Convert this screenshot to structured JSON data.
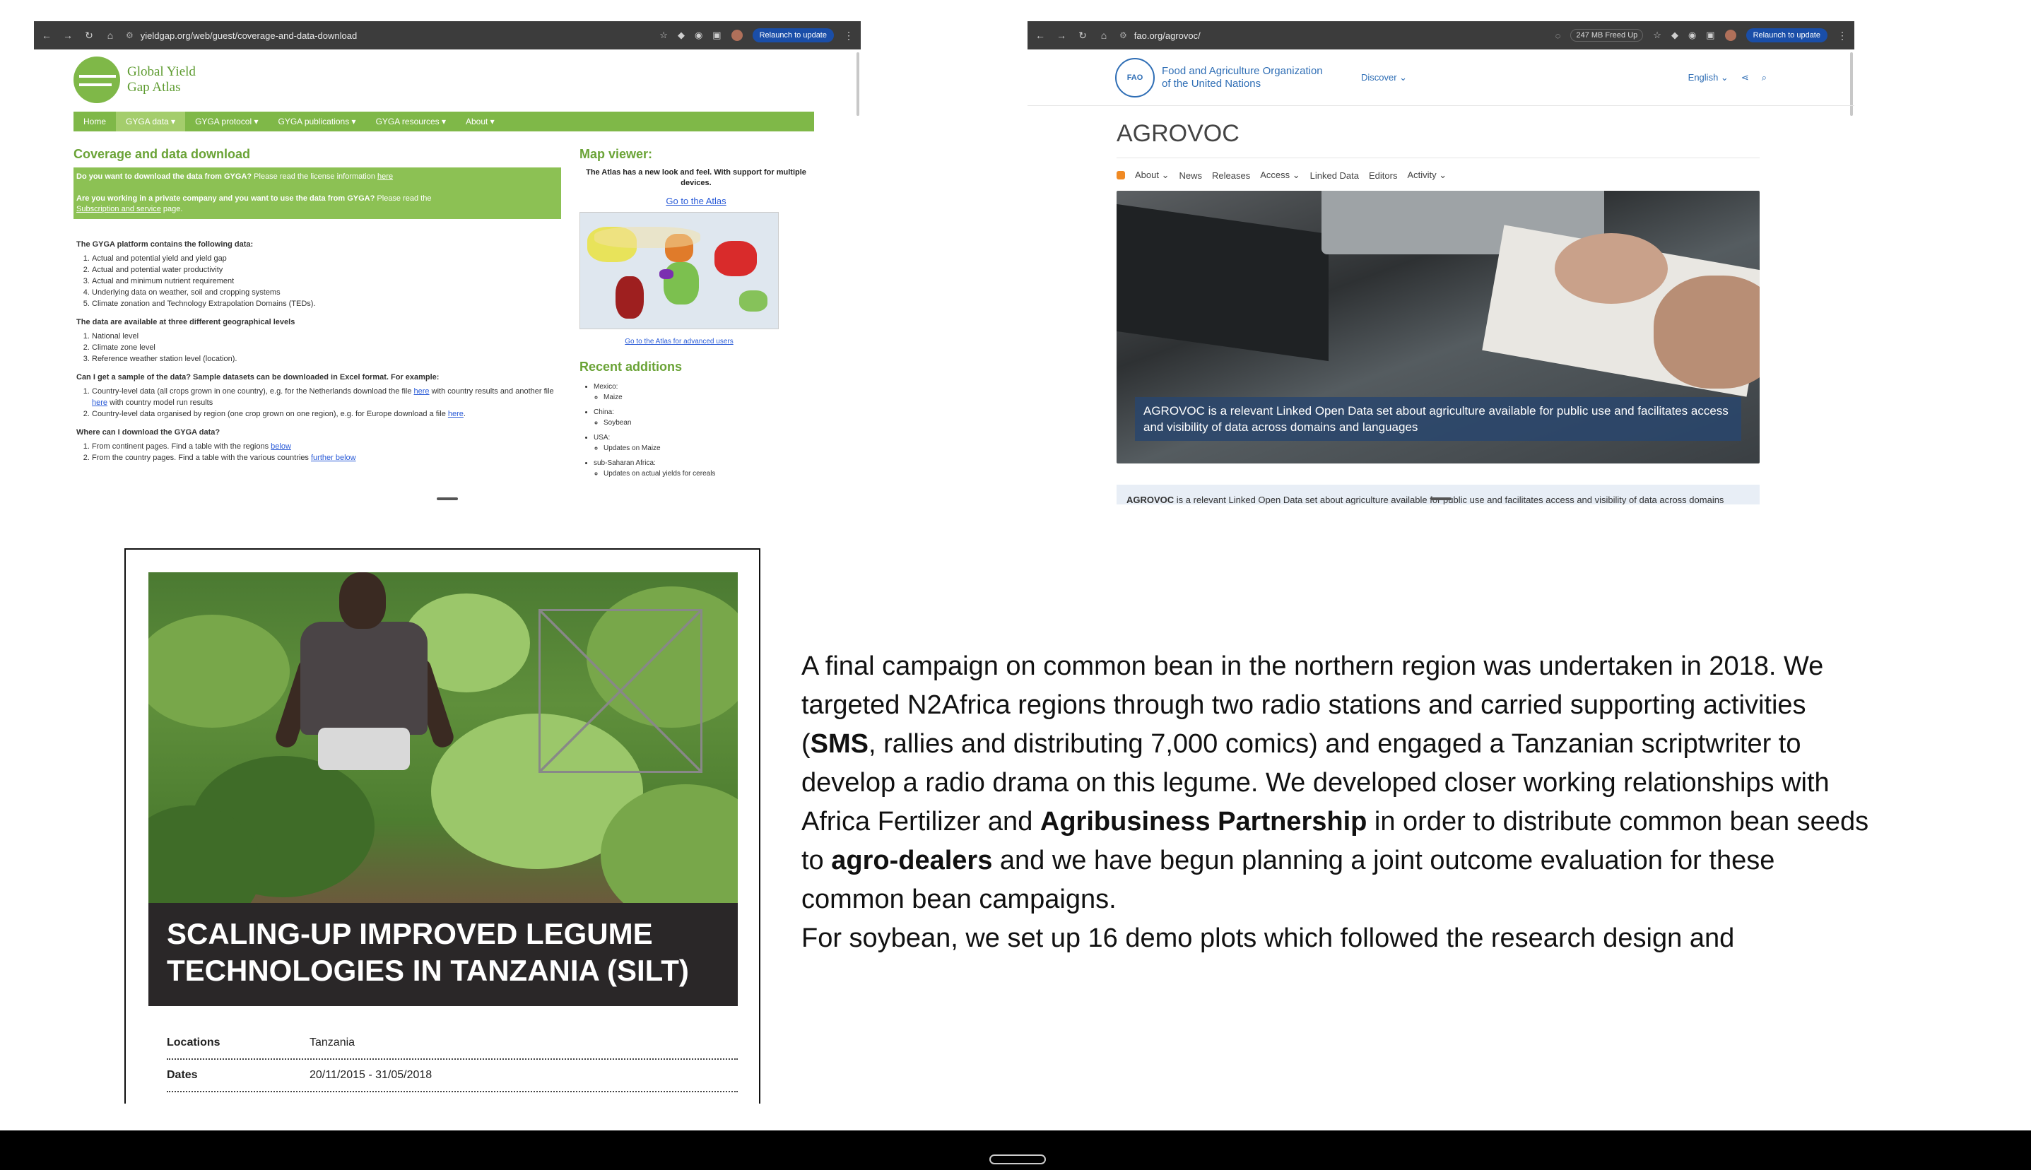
{
  "left_window": {
    "url": "yieldgap.org/web/guest/coverage-and-data-download",
    "relaunch": "Relaunch to update",
    "brand_line1": "Global Yield",
    "brand_line2": "Gap Atlas",
    "menu": [
      "Home",
      "GYGA data ▾",
      "GYGA protocol ▾",
      "GYGA publications ▾",
      "GYGA resources ▾",
      "About ▾"
    ],
    "page_title": "Coverage and data download",
    "box_q1_bold": "Do you want to download the data from GYGA?",
    "box_q1_rest": " Please read the license information ",
    "box_q1_link": "here",
    "box_q2_bold": "Are you working in a private company and you want to use the data from GYGA?",
    "box_q2_rest": " Please read the ",
    "box_q2_link": "Subscription and service",
    "box_q2_end": " page.",
    "section1_title": "The GYGA platform contains the following data:",
    "section1_items": [
      "Actual and potential yield and yield gap",
      "Actual and potential water productivity",
      "Actual and minimum nutrient requirement",
      "Underlying data on weather, soil and cropping systems",
      "Climate zonation and Technology Extrapolation Domains (TEDs)."
    ],
    "section2_title": "The data are available at three different geographical levels",
    "section2_items": [
      "National level",
      "Climate zone level",
      "Reference weather station level (location)."
    ],
    "section3_title": "Can I get a sample of the data? Sample datasets can be downloaded in Excel format. For example:",
    "section3_item1a": "Country-level data (all crops grown in one country), e.g. for the Netherlands download the file ",
    "section3_item1_link": "here",
    "section3_item1b": " with country results and another file ",
    "section3_item1_link2": "here",
    "section3_item1c": " with country model run results",
    "section3_item2a": "Country-level data organised by region (one crop grown on one region), e.g. for Europe download a file ",
    "section3_item2_link": "here",
    "section3_item2b": ".",
    "section4_title": "Where can I download the GYGA data?",
    "section4_item1a": "From continent pages. Find a table with the regions ",
    "section4_item1_link": "below",
    "section4_item2a": "From the country pages. Find a table with the various countries ",
    "section4_item2_link": "further below",
    "side_title": "Map viewer:",
    "side_text": "The Atlas has a new look and feel. With support for multiple devices.",
    "side_link": "Go to the Atlas",
    "side_small_link": "Go to the Atlas for advanced users",
    "recent_title": "Recent additions",
    "recent": [
      {
        "label": "Mexico:",
        "sub": "Maize"
      },
      {
        "label": "China:",
        "sub": "Soybean"
      },
      {
        "label": "USA:",
        "sub": "Updates on Maize"
      },
      {
        "label": "sub-Saharan Africa:",
        "sub": "Updates on actual yields for cereals"
      }
    ]
  },
  "right_window": {
    "url": "fao.org/agrovoc/",
    "freed": "247 MB Freed Up",
    "relaunch": "Relaunch to update",
    "org_line1": "Food and Agriculture Organization",
    "org_line2": "of the United Nations",
    "emblem": "FAO",
    "discover": "Discover ⌄",
    "language": "English ⌄",
    "title": "AGROVOC",
    "subnav": [
      "About ⌄",
      "News",
      "Releases",
      "Access ⌄",
      "Linked Data",
      "Editors",
      "Activity ⌄"
    ],
    "hero_caption": "AGROVOC is a relevant Linked Open Data set about agriculture available for public use and facilitates access and visibility of data across domains and languages",
    "strip_bold": "AGROVOC",
    "strip_rest": " is a relevant Linked Open Data set about agriculture available for public use and facilitates access and visibility of data across domains"
  },
  "document": {
    "banner_line1": "SCALING-UP IMPROVED LEGUME",
    "banner_line2": "TECHNOLOGIES IN TANZANIA (SILT)",
    "rows": [
      {
        "key": "Locations",
        "value": "Tanzania"
      },
      {
        "key": "Dates",
        "value": "20/11/2015 - 31/05/2018"
      }
    ]
  },
  "paragraph": {
    "t1": "A final campaign on common bean in the northern region was undertaken in 2018. We targeted N2Africa regions through two radio stations and carried supporting activities (",
    "b1": "SMS",
    "t2": ", rallies and distributing 7,000 comics) and engaged a Tanzanian scriptwriter to develop a radio drama on this legume. We developed closer working relationships with Africa Fertilizer and ",
    "b2": "Agribusiness Partnership",
    "t3": " in order to distribute common bean seeds to ",
    "b3": "agro-dealers",
    "t4": " and we have begun planning a joint outcome evaluation for these common bean campaigns.",
    "t5": "For soybean, we set up 16 demo plots which followed the research design and"
  },
  "colors": {
    "gyga_green": "#7fb848",
    "fao_blue": "#2f6eb5",
    "banner_dark": "#2a2728"
  }
}
